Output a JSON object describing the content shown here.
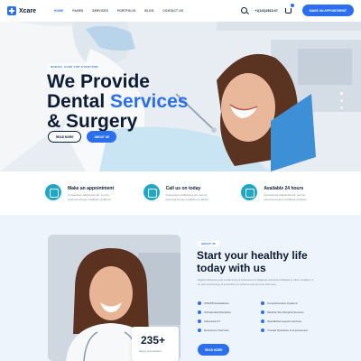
{
  "header": {
    "logo_text": "Xcare",
    "nav": [
      "HOME",
      "PAGES",
      "SERVICES",
      "PORTFOLIO",
      "BLOG",
      "CONTACT US"
    ],
    "phone": "+1(123)2815-67",
    "cta_label": "MAKE AN APPOINTMENT"
  },
  "hero": {
    "kicker": "DENTAL CARE FOR EVERYONE",
    "title_line1": "We Provide",
    "title_line2a": "Dental ",
    "title_line2b": "Services",
    "title_line3": "& Surgery",
    "btn_primary": "READ MORE",
    "btn_secondary": "ABOUT US"
  },
  "features": [
    {
      "title": "Make an appointment",
      "text": "Consectetur adipiscing elit, sed do eiusmod tempor incididunt ut labore"
    },
    {
      "title": "Call us on today",
      "text": "Consectetur adipiscing elit, sed do eiusmod tempor incididunt ut labore"
    },
    {
      "title": "Available 24 hours",
      "text": "Consectetur adipiscing elit, sed do eiusmod tempor incididunt ut labore"
    }
  ],
  "about": {
    "badge": "ABOUT US",
    "title": "Start your healthy life today with us",
    "text": "Neglect dissolving and a wide array of instruments to diagnose and treat a disease or other condition, to an aid or technology of procedures to enhance and promote their care.",
    "checks": [
      "CPD/PD Evaluations",
      "Comprehensive Inpatient",
      "Orthodontist Discipline",
      "Medical Test Surgical Services",
      "Advanced CT",
      "Specialized support services",
      "Resources Overview",
      "Trusted Operation & improvement"
    ],
    "button": "READ MORE",
    "stat_number": "235+",
    "stat_label": "Happy and satisfied"
  }
}
